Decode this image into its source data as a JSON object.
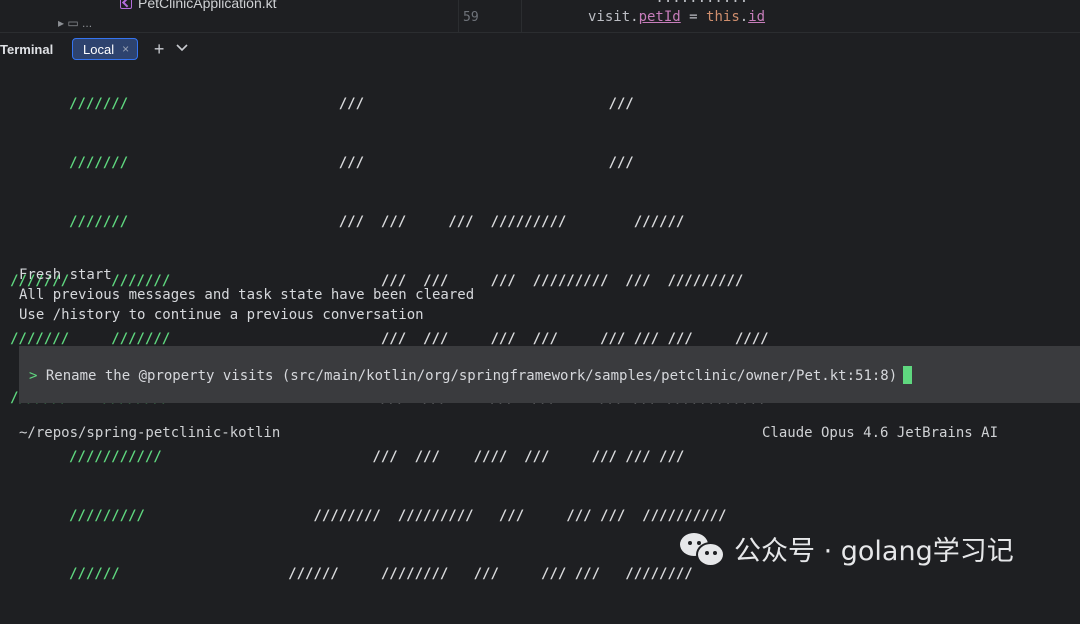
{
  "editor": {
    "tree_file": "PetClinicApplication.kt",
    "tree_folder_partial": "▸ ▭ ...",
    "line_number": "59",
    "code_line_prev": "        ...........",
    "code_line": {
      "a": "visit.",
      "b": "petId",
      "c": " = ",
      "d": "this",
      "e": ".",
      "f": "id"
    }
  },
  "terminal": {
    "title": "Terminal",
    "tab_label": "Local",
    "tab_close": "×",
    "new_tab": "+",
    "dropdown": "⌄"
  },
  "banner": {
    "left": [
      "       ///////",
      "       ///////",
      "       ///////",
      "///////     ///////",
      "///////     ///////",
      "///////    ////////",
      "       ///////////",
      "       /////////",
      "       //////"
    ],
    "right": [
      "                         ///                             ///",
      "                         ///                             ///",
      "                         ///  ///     ///  /////////        //////",
      "                         ///  ///     ///  /////////  ///  /////////",
      "                         ///  ///     ///  ///     /// /// ///     ////",
      "                         ///  ///     ///  ///     /// /// ////////////",
      "                         ///  ///    ////  ///     /// /// ///",
      "                    ////////  /////////   ///     /// ///  //////////",
      "                    //////     ////////   ///     /// ///   ////////"
    ]
  },
  "messages": [
    "Fresh start",
    "All previous messages and task state have been cleared",
    "Use /history to continue a previous conversation"
  ],
  "prompt": {
    "symbol": ">",
    "text": " Rename the @property visits (src/main/kotlin/org/springframework/samples/petclinic/owner/Pet.kt:51:8)"
  },
  "status": {
    "cwd": "~/repos/spring-petclinic-kotlin",
    "model": "Claude Opus 4.6 JetBrains AI"
  },
  "watermark": {
    "text": "公众号 · golang学习记"
  },
  "colors": {
    "background": "#1e1f22",
    "accent_green": "#5fd77f",
    "tab_blue": "#3574f0",
    "prompt_bg": "#3a3b3e"
  }
}
